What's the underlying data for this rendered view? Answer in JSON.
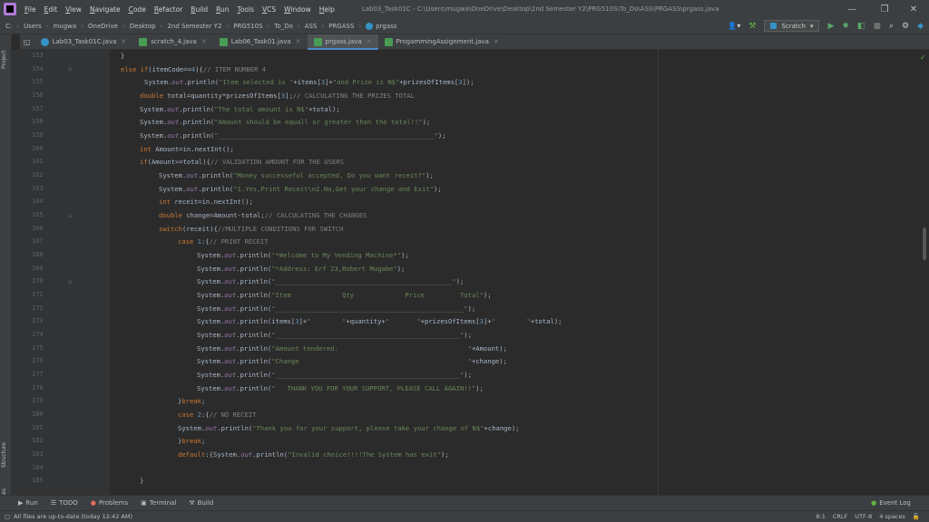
{
  "menu": {
    "items": [
      "File",
      "Edit",
      "View",
      "Navigate",
      "Code",
      "Refactor",
      "Build",
      "Run",
      "Tools",
      "VCS",
      "Window",
      "Help"
    ],
    "window_title": "Lab03_Task01C - C:\\Users\\mugwa\\OneDrive\\Desktop\\2nd Semester Y2\\PRG510S\\To_Do\\ASS\\PRGASS\\prgass.java"
  },
  "breadcrumb": [
    "C:",
    "Users",
    "mugwa",
    "OneDrive",
    "Desktop",
    "2nd Semester Y2",
    "PRG510S",
    "To_Do",
    "ASS",
    "PRGASS",
    "prgass"
  ],
  "toolbar": {
    "run_config": "Scratch"
  },
  "tabs": [
    {
      "label": "Lab03_Task01C.java",
      "color": "#3592c4"
    },
    {
      "label": "scratch_4.java",
      "color": "#499c54"
    },
    {
      "label": "Lab06_Task01.java",
      "color": "#499c54"
    },
    {
      "label": "prgass.java",
      "color": "#499c54"
    },
    {
      "label": "ProgammingAssignment.java",
      "color": "#499c54"
    }
  ],
  "side_panels": {
    "project": "Project",
    "structure": "Structure",
    "favorites": "Favorites"
  },
  "gutter": {
    "first_line": "153",
    "lines": [
      "154",
      "155",
      "156",
      "157",
      "158",
      "159",
      "160",
      "161",
      "162",
      "163",
      "164",
      "165",
      "166",
      "167",
      "168",
      "169",
      "170",
      "171",
      "172",
      "173",
      "174",
      "175",
      "176",
      "177",
      "178",
      "179",
      "180",
      "181",
      "182",
      "183",
      "184",
      "185"
    ]
  },
  "code": {
    "l153": "}",
    "l154a": "else if",
    "l154b": "(itemCode==",
    "l154c": "4",
    "l154d": "){",
    "l154e": "// ITEM NUMBER 4",
    "l155a": "System.",
    "l155b": "out",
    "l155c": ".println(",
    "l155d": "\"Item selected is \"",
    "l155e": "+items[",
    "l155f": "3",
    "l155g": "]+",
    "l155h": "\"and Prize is N$\"",
    "l155i": "+prizesOfItems[",
    "l155j": "3",
    "l155k": "]);",
    "l156a": "double",
    "l156b": " total=quantity*prizesOfItems[",
    "l156c": "3",
    "l156d": "];",
    "l156e": "// CALCULATING THE PRIZES TOTAL",
    "l157a": ".println(",
    "l157b": "\"The total amount is N$\"",
    "l157c": "+total);",
    "l158b": "\"Amount should be equall or greater than the total!!\"",
    "l158c": ");",
    "l159b": "\"_______________________________________________________\"",
    "l160a": "int",
    "l160b": " Amount=in.nextInt();",
    "l161a": "if",
    "l161b": "(Amount>=total){",
    "l161c": "// VALIDATION AMOUNT FOR THE USERS",
    "l162b": "\"Money successeful accepted, Do you want receit?\"",
    "l163b": "\"1.Yes,Print Receit\\n2.No,Get your change and Exit\"",
    "l164a": "int",
    "l164b": " receit=in.nextInt();",
    "l165a": "double",
    "l165b": " change=Amount-total;",
    "l165c": "// CALCULATING THE CHANGES",
    "l166a": "switch",
    "l166b": "(receit){",
    "l166c": "//MULTIPLE CONDITIONS FOR SWITCH",
    "l167a": "case",
    "l167b": " 1",
    "l167c": ":{",
    "l167d": "// PRINT RECEIT",
    "l168b": "\"*Welcome to My Vending Machine*\"",
    "l169b": "\"*Address: Erf 23,Robert Mugabe\"",
    "l170b": "\"_____________________________________________\"",
    "l171b": "\"Item             Qty             Price         Total\"",
    "l172b": "\"________________________________________________\"",
    "l173a": ".println(items[",
    "l173b": "3",
    "l173c": "]+",
    "l173d": "\"        \"",
    "l173e": "+quantity+",
    "l173f": "\"       \"",
    "l173g": "+prizesOfItems[",
    "l173h": "3",
    "l173i": "]+",
    "l173j": "\"        \"",
    "l173k": "+total);",
    "l174b": "\"_______________________________________________\"",
    "l175b": "\"Amount tendered:                                 \"",
    "l175c": "+Amount);",
    "l176b": "\"Change                                           \"",
    "l176c": "+change);",
    "l177b": "\"_______________________________________________\"",
    "l178b": "\"   THANK YOU FOR YOUR SUPPORT, PLEASE CALL AGAIN!!\"",
    "l179a": "}",
    "l179b": "break",
    "l179c": ";",
    "l180a": "case",
    "l180b": " 2",
    "l180c": ":{",
    "l180d": "// NO RECEIT",
    "l181b": "\"Thank you for your support, please take your change of N$\"",
    "l181c": "+change);",
    "l182a": "}",
    "l182b": "break",
    "l182c": ";",
    "l183a": "default",
    "l183b": ":{",
    "l183c": "System.",
    "l183d": "out",
    "l183e": ".println(",
    "l183f": "\"Invalid choice!!!!The System has exit\"",
    "l183g": ");",
    "l185": "}"
  },
  "bottom_tabs": [
    "Run",
    "TODO",
    "Problems",
    "Terminal",
    "Build"
  ],
  "event_log": "Event Log",
  "status": {
    "message": "All files are up-to-date (today 12:42 AM)",
    "position": "8:1",
    "line_sep": "CRLF",
    "encoding": "UTF-8",
    "indent": "4 spaces"
  }
}
